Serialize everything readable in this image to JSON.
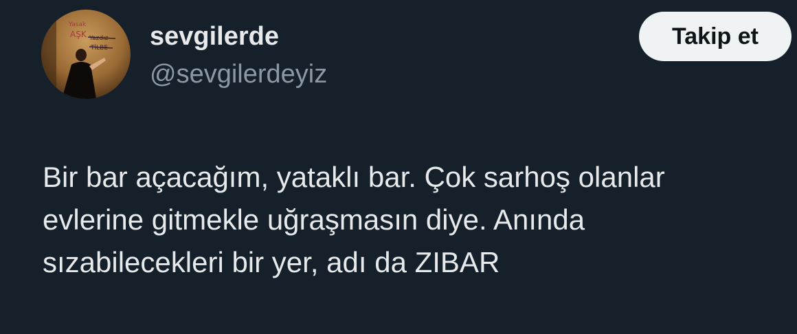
{
  "theme": {
    "background": "#15202b",
    "primary_text": "#e7e9ea",
    "secondary_text": "#8b98a5",
    "button_background": "#eff3f4",
    "button_text": "#0f1419"
  },
  "author": {
    "display_name": "sevgilerde",
    "handle": "@sevgilerdeyiz",
    "avatar_icon": "profile-photo",
    "avatar_wall_text": [
      "Yasak",
      "AŞK",
      "Yazdız",
      "TİLBE"
    ]
  },
  "follow_button": {
    "label": "Takip et"
  },
  "tweet": {
    "lines": [
      "Bir bar açacağım, yataklı bar. Çok sarhoş olanlar",
      "evlerine gitmekle uğraşmasın diye. Anında",
      "sızabilecekleri bir yer, adı da ZIBAR"
    ]
  }
}
